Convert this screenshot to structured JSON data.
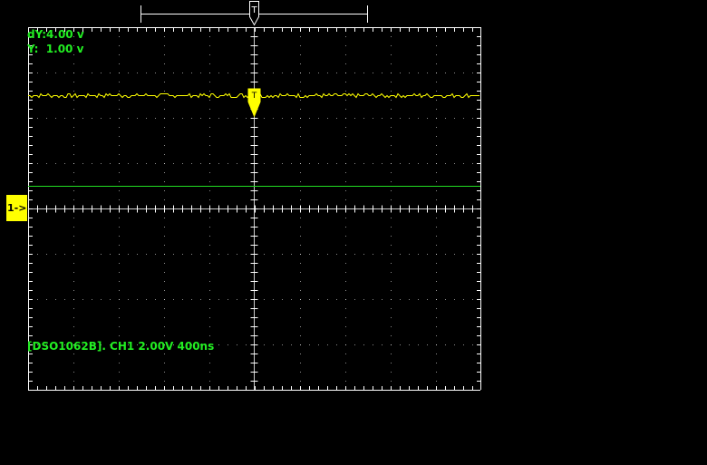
{
  "readouts": {
    "dy": "dY:4.00 v",
    "y": "Y:  1.00 v"
  },
  "status_line": "[DSO1062B]. CH1 2.00V 400ns",
  "channel_marker": "1->",
  "trigger_label": "T",
  "colors": {
    "background": "#000000",
    "grid": "#ffffff",
    "trace": "#ffff00",
    "cursor": "#22dd22",
    "text": "#22ee22"
  }
}
